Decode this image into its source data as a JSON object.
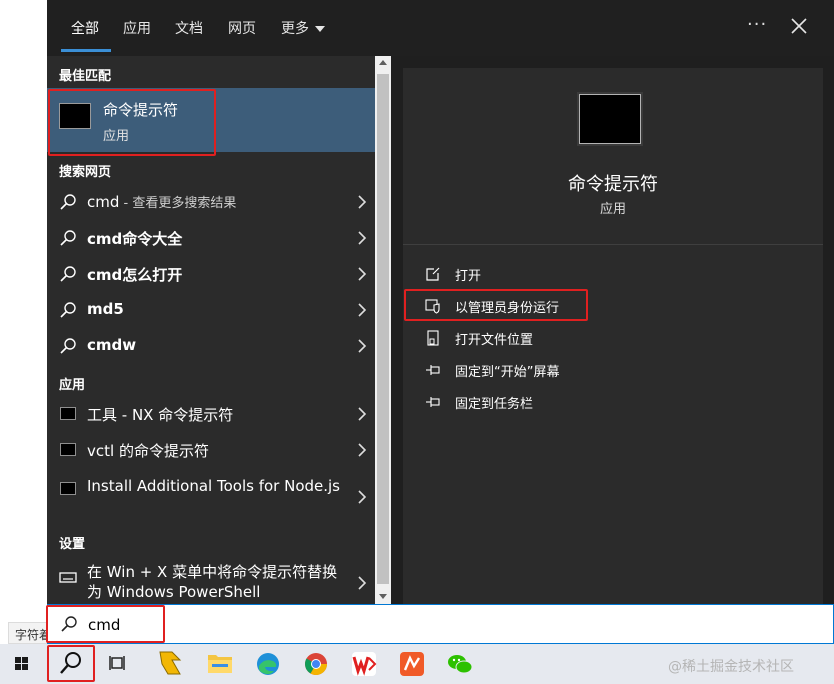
{
  "background": {
    "tab_text": "字符着"
  },
  "nav": {
    "tabs": [
      "全部",
      "应用",
      "文档",
      "网页",
      "更多"
    ],
    "active_index": 0,
    "more_options": "···"
  },
  "left": {
    "best_match_header": "最佳匹配",
    "best_match": {
      "title": "命令提示符",
      "subtitle": "应用"
    },
    "web_header": "搜索网页",
    "web_results": [
      {
        "main": "cmd",
        "suffix": " - 查看更多搜索结果"
      },
      {
        "main": "cmd命令大全",
        "suffix": ""
      },
      {
        "main": "cmd怎么打开",
        "suffix": ""
      },
      {
        "main": "md5",
        "suffix": ""
      },
      {
        "main": "cmdw",
        "suffix": ""
      }
    ],
    "apps_header": "应用",
    "apps": [
      {
        "label": "工具 - NX 命令提示符"
      },
      {
        "label": "vctl 的命令提示符"
      },
      {
        "label": "Install Additional Tools for Node.js"
      }
    ],
    "settings_header": "设置",
    "settings": [
      {
        "label": "在 Win + X 菜单中将命令提示符替换为 Windows PowerShell"
      }
    ]
  },
  "detail": {
    "app_name": "命令提示符",
    "app_type": "应用",
    "actions": [
      {
        "label": "打开",
        "icon": "open-icon"
      },
      {
        "label": "以管理员身份运行",
        "icon": "shield-admin-icon"
      },
      {
        "label": "打开文件位置",
        "icon": "file-location-icon"
      },
      {
        "label": "固定到“开始”屏幕",
        "icon": "pin-icon"
      },
      {
        "label": "固定到任务栏",
        "icon": "pin-icon"
      }
    ]
  },
  "search": {
    "value": "cmd"
  },
  "taskbar": {
    "items": [
      "windows-start",
      "search",
      "task-view",
      "app-yellow",
      "file-explorer",
      "edge",
      "chrome",
      "wps",
      "app-red",
      "wechat"
    ],
    "watermark": "@稀土掘金技术社区"
  },
  "colors": {
    "accent": "#3b8fd6",
    "selection": "#3d5d7a",
    "panel": "#2b2b2b",
    "annotation": "#e02020"
  }
}
